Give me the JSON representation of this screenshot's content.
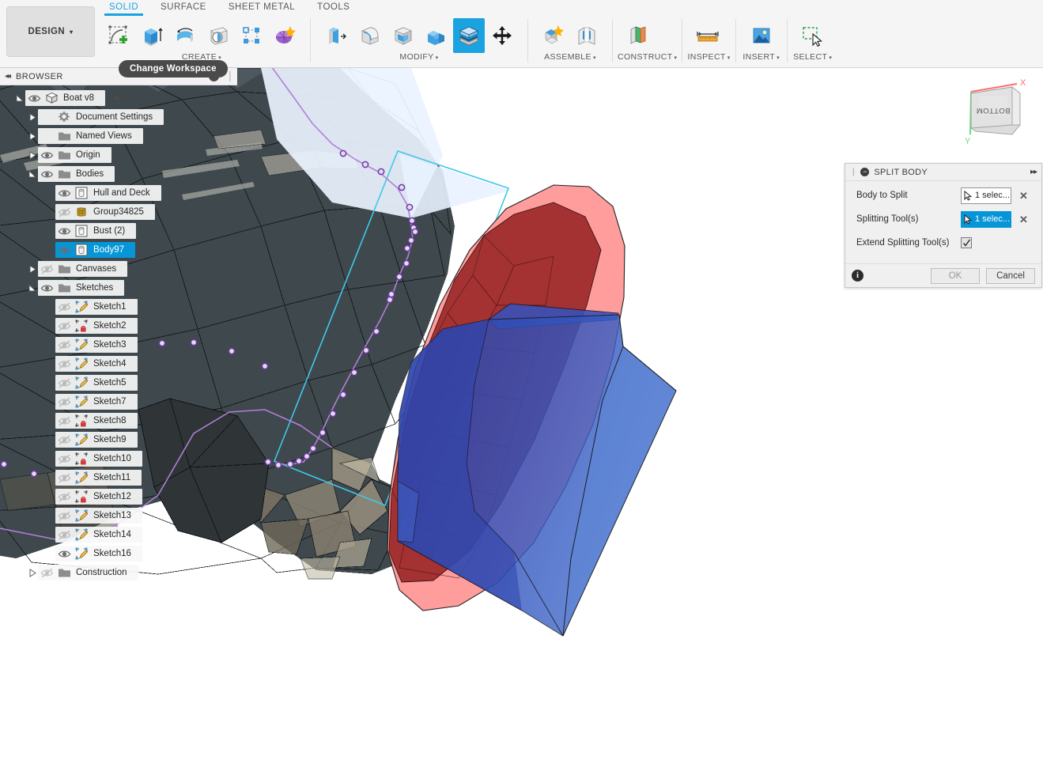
{
  "app": {
    "workspace_button": "DESIGN",
    "tooltip": "Change Workspace",
    "tabs": [
      {
        "label": "SOLID",
        "active": true
      },
      {
        "label": "SURFACE",
        "active": false
      },
      {
        "label": "SHEET METAL",
        "active": false
      },
      {
        "label": "TOOLS",
        "active": false
      }
    ]
  },
  "ribbon": {
    "groups": [
      {
        "label": "CREATE",
        "caret": "▾",
        "icons": [
          {
            "name": "create-sketch-icon"
          },
          {
            "name": "extrude-icon"
          },
          {
            "name": "revolve-icon"
          },
          {
            "name": "sweep-icon"
          },
          {
            "name": "pattern-icon"
          },
          {
            "name": "create-form-icon"
          }
        ]
      },
      {
        "label": "MODIFY",
        "caret": "▾",
        "icons": [
          {
            "name": "press-pull-icon"
          },
          {
            "name": "fillet-icon"
          },
          {
            "name": "shell-icon"
          },
          {
            "name": "combine-icon"
          },
          {
            "name": "split-body-icon",
            "selected": true
          },
          {
            "name": "move-copy-icon"
          }
        ]
      },
      {
        "label": "ASSEMBLE",
        "caret": "▾",
        "icons": [
          {
            "name": "new-component-icon"
          },
          {
            "name": "joint-icon"
          }
        ]
      },
      {
        "label": "CONSTRUCT",
        "caret": "▾",
        "icons": [
          {
            "name": "offset-plane-icon"
          }
        ]
      },
      {
        "label": "INSPECT",
        "caret": "▾",
        "icons": [
          {
            "name": "measure-icon"
          }
        ]
      },
      {
        "label": "INSERT",
        "caret": "▾",
        "icons": [
          {
            "name": "insert-image-icon"
          }
        ]
      },
      {
        "label": "SELECT",
        "caret": "▾",
        "icons": [
          {
            "name": "select-window-icon"
          }
        ]
      }
    ]
  },
  "browser": {
    "title": "BROWSER",
    "collapse_icon": "◂◂",
    "minimize_icon": "−",
    "tree": [
      {
        "label": "Boat v8",
        "indent": 0,
        "expander": "collapse",
        "eye": "visible",
        "icon": "component-icon",
        "selected": false,
        "radio": true
      },
      {
        "label": "Document Settings",
        "indent": 1,
        "expander": "expand",
        "eye": "none",
        "icon": "gear-icon",
        "selected": false
      },
      {
        "label": "Named Views",
        "indent": 1,
        "expander": "expand",
        "eye": "none",
        "icon": "folder-icon",
        "selected": false
      },
      {
        "label": "Origin",
        "indent": 1,
        "expander": "expand",
        "eye": "visible",
        "icon": "folder-icon",
        "selected": false
      },
      {
        "label": "Bodies",
        "indent": 1,
        "expander": "collapse",
        "eye": "visible",
        "icon": "folder-icon",
        "selected": false
      },
      {
        "label": "Hull and Deck",
        "indent": 2,
        "expander": "none",
        "eye": "visible",
        "icon": "body-icon",
        "selected": false
      },
      {
        "label": "Group34825",
        "indent": 2,
        "expander": "none",
        "eye": "hidden",
        "icon": "mesh-body-icon",
        "selected": false
      },
      {
        "label": "Bust (2)",
        "indent": 2,
        "expander": "none",
        "eye": "visible",
        "icon": "body-icon",
        "selected": false
      },
      {
        "label": "Body97",
        "indent": 2,
        "expander": "none",
        "eye": "visible",
        "icon": "body-icon",
        "selected": true
      },
      {
        "label": "Canvases",
        "indent": 1,
        "expander": "expand",
        "eye": "hidden",
        "icon": "folder-icon",
        "selected": false
      },
      {
        "label": "Sketches",
        "indent": 1,
        "expander": "collapse",
        "eye": "visible",
        "icon": "folder-icon",
        "selected": false
      },
      {
        "label": "Sketch1",
        "indent": 2,
        "expander": "none",
        "eye": "hidden",
        "icon": "sketch-icon",
        "selected": false
      },
      {
        "label": "Sketch2",
        "indent": 2,
        "expander": "none",
        "eye": "hidden",
        "icon": "sketch-locked-icon",
        "selected": false
      },
      {
        "label": "Sketch3",
        "indent": 2,
        "expander": "none",
        "eye": "hidden",
        "icon": "sketch-icon",
        "selected": false
      },
      {
        "label": "Sketch4",
        "indent": 2,
        "expander": "none",
        "eye": "hidden",
        "icon": "sketch-icon",
        "selected": false
      },
      {
        "label": "Sketch5",
        "indent": 2,
        "expander": "none",
        "eye": "hidden",
        "icon": "sketch-icon",
        "selected": false
      },
      {
        "label": "Sketch7",
        "indent": 2,
        "expander": "none",
        "eye": "hidden",
        "icon": "sketch-icon",
        "selected": false
      },
      {
        "label": "Sketch8",
        "indent": 2,
        "expander": "none",
        "eye": "hidden",
        "icon": "sketch-locked-icon",
        "selected": false
      },
      {
        "label": "Sketch9",
        "indent": 2,
        "expander": "none",
        "eye": "hidden",
        "icon": "sketch-icon",
        "selected": false
      },
      {
        "label": "Sketch10",
        "indent": 2,
        "expander": "none",
        "eye": "hidden",
        "icon": "sketch-locked-icon",
        "selected": false
      },
      {
        "label": "Sketch11",
        "indent": 2,
        "expander": "none",
        "eye": "hidden",
        "icon": "sketch-icon",
        "selected": false
      },
      {
        "label": "Sketch12",
        "indent": 2,
        "expander": "none",
        "eye": "hidden",
        "icon": "sketch-locked-icon",
        "selected": false
      },
      {
        "label": "Sketch13",
        "indent": 2,
        "expander": "none",
        "eye": "hidden",
        "icon": "sketch-icon",
        "selected": false
      },
      {
        "label": "Sketch14",
        "indent": 2,
        "expander": "none",
        "eye": "hidden",
        "icon": "sketch-icon",
        "selected": false
      },
      {
        "label": "Sketch16",
        "indent": 2,
        "expander": "none",
        "eye": "visible",
        "icon": "sketch-icon",
        "selected": false
      },
      {
        "label": "Construction",
        "indent": 1,
        "expander": "expand",
        "eye": "hidden",
        "icon": "folder-icon",
        "selected": false
      }
    ]
  },
  "split_body_dialog": {
    "title": "SPLIT BODY",
    "grip": "❘",
    "collapse_icon": "−",
    "expand_icon": "▸▸",
    "rows": [
      {
        "label": "Body to Split",
        "value": "1 selec...",
        "active": false,
        "clear": "✕"
      },
      {
        "label": "Splitting Tool(s)",
        "value": "1 selec...",
        "active": true,
        "clear": "✕"
      }
    ],
    "checkbox_label": "Extend Splitting Tool(s)",
    "checkbox_checked": true,
    "info_icon": "i",
    "ok_label": "OK",
    "cancel_label": "Cancel"
  },
  "viewcube": {
    "face_label": "BOTTOM",
    "axis_x": "X",
    "axis_y": "Y",
    "color_x": "#ff6b6b",
    "color_y": "#5fe07a"
  },
  "colors": {
    "accent": "#0696d7",
    "tab_active": "#1aa3e0",
    "toolbar_bg": "#f5f5f5",
    "selection_blue": "#3b5fc0",
    "highlight_red": "#ff9a9a",
    "mesh_dark": "#3d464b",
    "sketch_purple": "#b07fd8",
    "sketch_cyan": "#3fc8e8"
  }
}
